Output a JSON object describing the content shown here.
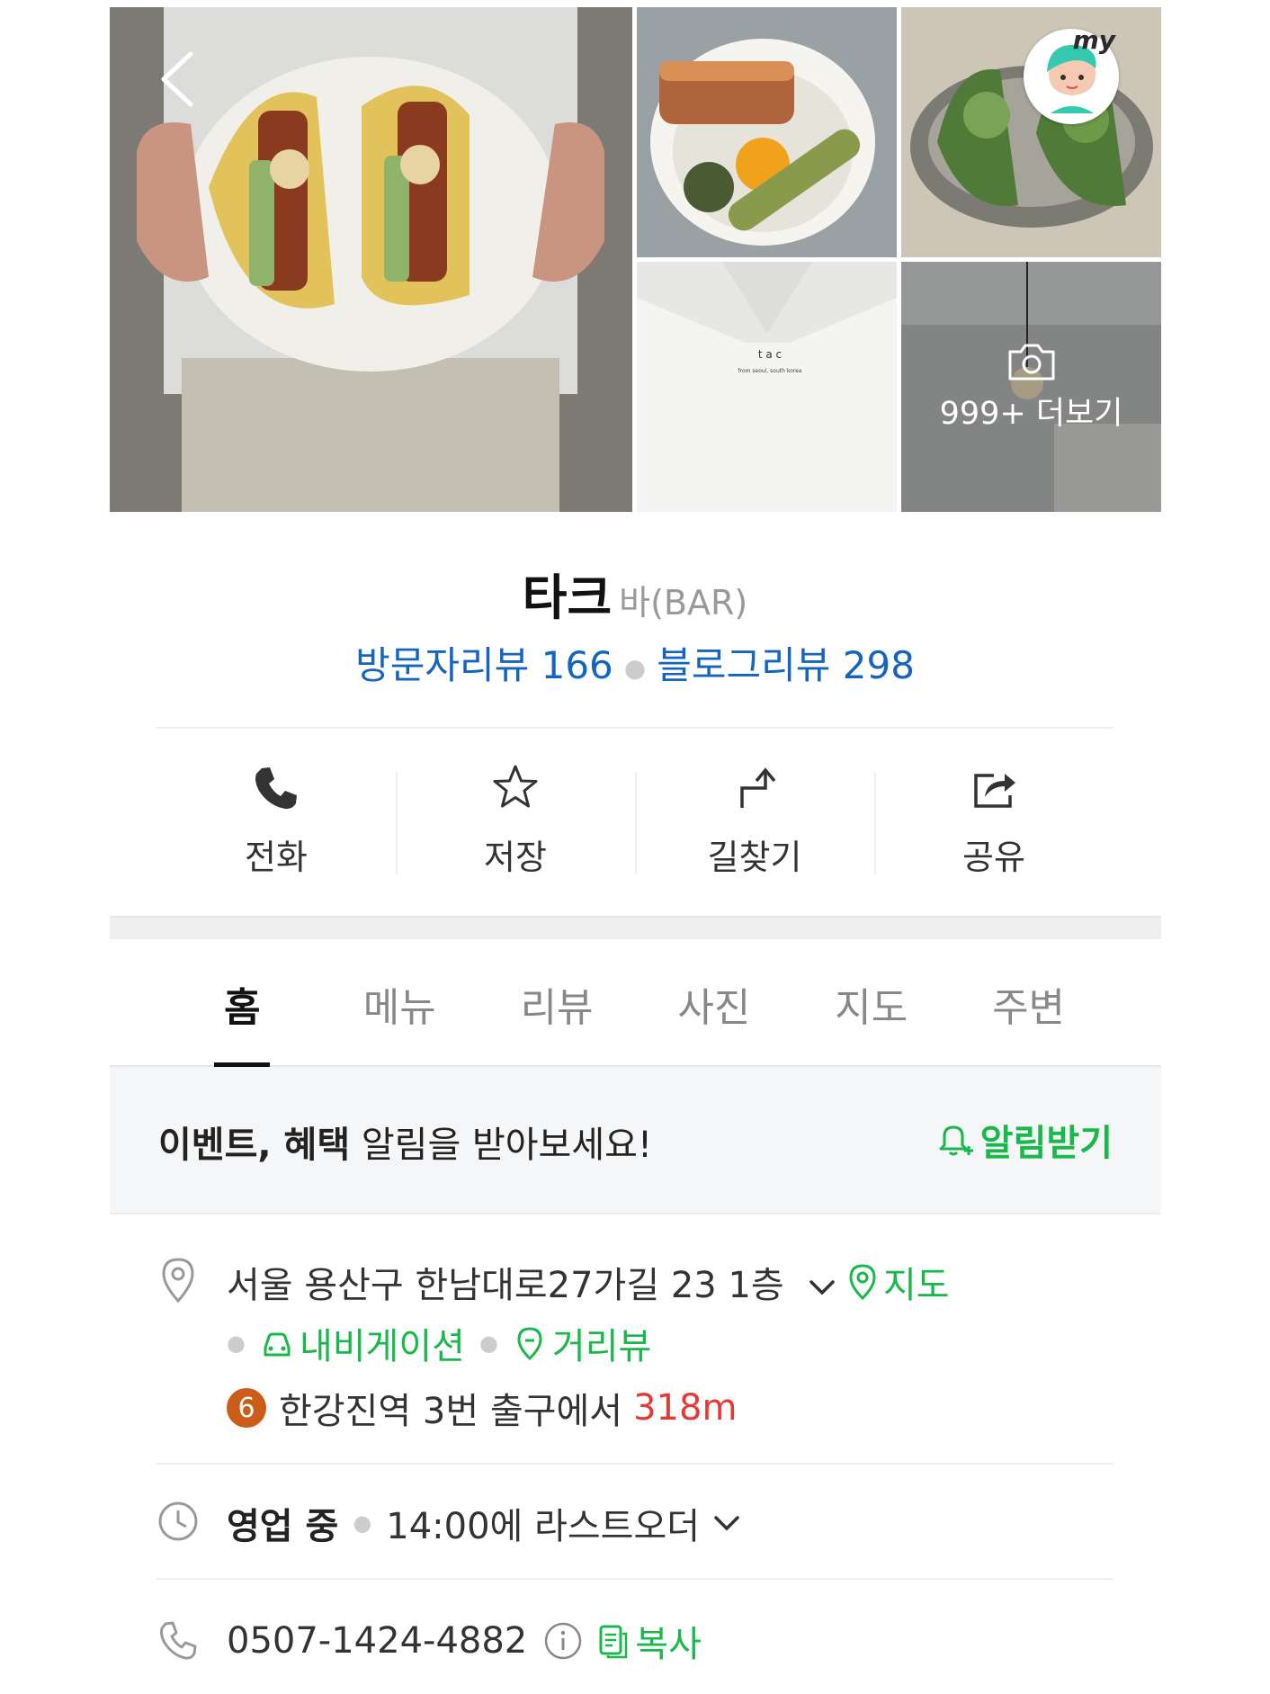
{
  "gallery": {
    "more_label": "999+ 더보기",
    "badge_text": "my"
  },
  "place": {
    "name": "타크",
    "category": "바(BAR)",
    "visitor_reviews": "방문자리뷰 166",
    "blog_reviews": "블로그리뷰 298"
  },
  "actions": [
    {
      "label": "전화",
      "icon": "phone-icon"
    },
    {
      "label": "저장",
      "icon": "star-icon"
    },
    {
      "label": "길찾기",
      "icon": "directions-icon"
    },
    {
      "label": "공유",
      "icon": "share-icon"
    }
  ],
  "tabs": [
    {
      "label": "홈",
      "active": true
    },
    {
      "label": "메뉴"
    },
    {
      "label": "리뷰"
    },
    {
      "label": "사진"
    },
    {
      "label": "지도"
    },
    {
      "label": "주변"
    }
  ],
  "notice": {
    "bold": "이벤트, 혜택",
    "text": " 알림을 받아보세요!",
    "button": "알림받기"
  },
  "info": {
    "address": "서울 용산구 한남대로27가길 23 1층",
    "map_label": "지도",
    "navigation_label": "내비게이션",
    "streetview_label": "거리뷰",
    "subway_line": "6",
    "subway_text": "한강진역 3번 출구에서",
    "subway_distance": "318m",
    "hours_status": "영업 중",
    "hours_detail": "14:00에 라스트오더",
    "phone": "0507-1424-4882",
    "copy_label": "복사"
  },
  "colors": {
    "link_blue": "#1565c0",
    "green": "#19b84b",
    "distance_red": "#e53935",
    "line6": "#cc5d18"
  }
}
